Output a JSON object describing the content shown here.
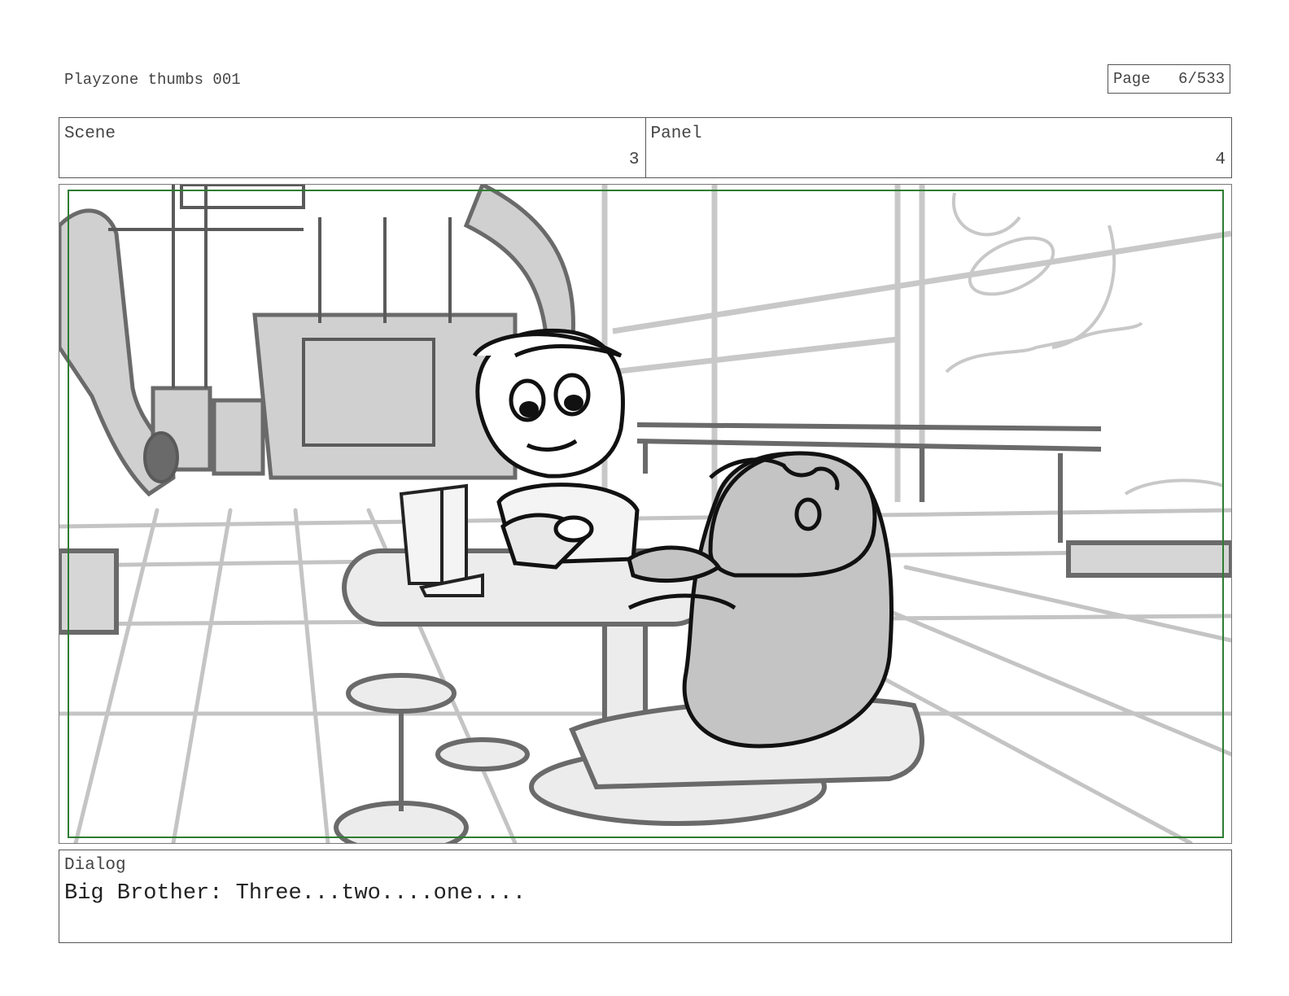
{
  "document": {
    "title": "Playzone thumbs 001",
    "page_label": "Page",
    "page_number": "6/533"
  },
  "header": {
    "scene_label": "Scene",
    "scene_value": "3",
    "panel_label": "Panel",
    "panel_value": "4"
  },
  "dialog": {
    "label": "Dialog",
    "text": "Big Brother: Three...two....one...."
  }
}
